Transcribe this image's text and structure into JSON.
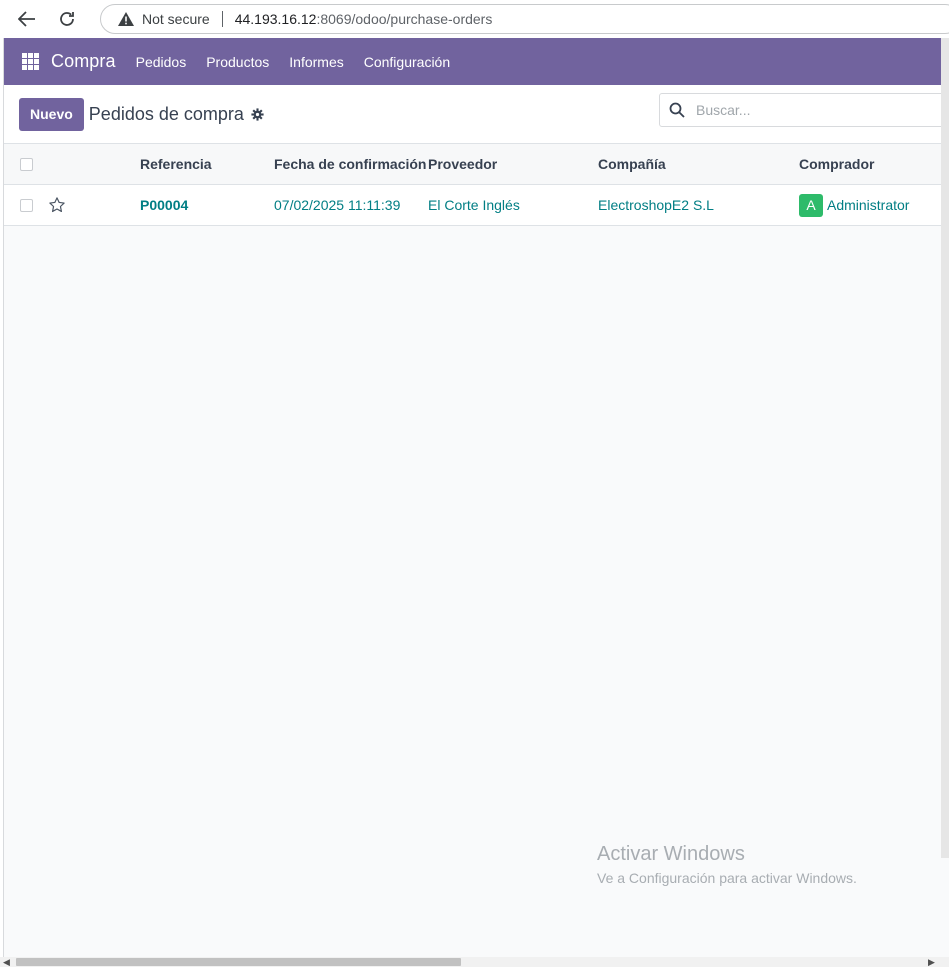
{
  "browser": {
    "security_label": "Not secure",
    "url_host": "44.193.16.12",
    "url_path": ":8069/odoo/purchase-orders"
  },
  "navbar": {
    "brand": "Compra",
    "menu": [
      "Pedidos",
      "Productos",
      "Informes",
      "Configuración"
    ],
    "color": "#71639e"
  },
  "control_panel": {
    "new_button": "Nuevo",
    "title": "Pedidos de compra",
    "search_placeholder": "Buscar..."
  },
  "table": {
    "columns": [
      "Referencia",
      "Fecha de confirmación",
      "Proveedor",
      "Compañía",
      "Comprador"
    ],
    "rows": [
      {
        "reference": "P00004",
        "confirmation_date": "07/02/2025 11:11:39",
        "vendor": "El Corte Inglés",
        "company": "ElectroshopE2 S.L",
        "buyer_initial": "A",
        "buyer": "Administrator"
      }
    ]
  },
  "watermark": {
    "title": "Activar Windows",
    "subtitle": "Ve a Configuración para activar Windows."
  }
}
